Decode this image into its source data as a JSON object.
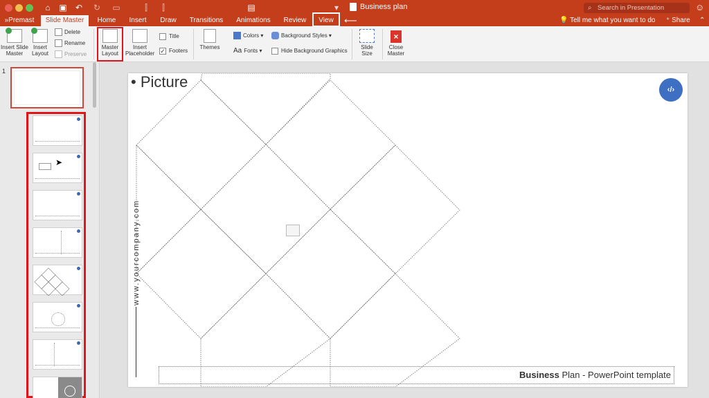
{
  "window": {
    "title": "Business plan"
  },
  "search": {
    "placeholder": "Search in Presentation"
  },
  "tabs": [
    {
      "label": "Premast"
    },
    {
      "label": "Slide Master",
      "active": true
    },
    {
      "label": "Home"
    },
    {
      "label": "Insert"
    },
    {
      "label": "Draw"
    },
    {
      "label": "Transitions"
    },
    {
      "label": "Animations"
    },
    {
      "label": "Review"
    },
    {
      "label": "View"
    }
  ],
  "tabbar": {
    "tell": "Tell me what you want to do",
    "share": "Share",
    "annotation_arrow": "⟵"
  },
  "ribbon": {
    "insert_slide_master": "Insert Slide Master",
    "insert_layout": "Insert Layout",
    "delete": "Delete",
    "rename": "Rename",
    "preserve": "Preserve",
    "master_layout": "Master Layout",
    "insert_placeholder": "Insert Placeholder",
    "title": "Title",
    "footers": "Footers",
    "themes": "Themes",
    "colors": "Colors",
    "fonts": "Fonts",
    "background_styles": "Background Styles",
    "hide_background_graphics": "Hide Background Graphics",
    "slide_size": "Slide Size",
    "close_master": "Close Master"
  },
  "panel": {
    "slide_number": "1"
  },
  "slide": {
    "title": "Picture",
    "logo_text": "&#8250;",
    "vertical_text": "www.yourcompany.com",
    "footer_bold": "Business",
    "footer_rest": " Plan - PowerPoint template"
  },
  "colors": {
    "accent": "#c43e1c",
    "highlight": "#e0141a",
    "logo": "#3e6fc2"
  }
}
